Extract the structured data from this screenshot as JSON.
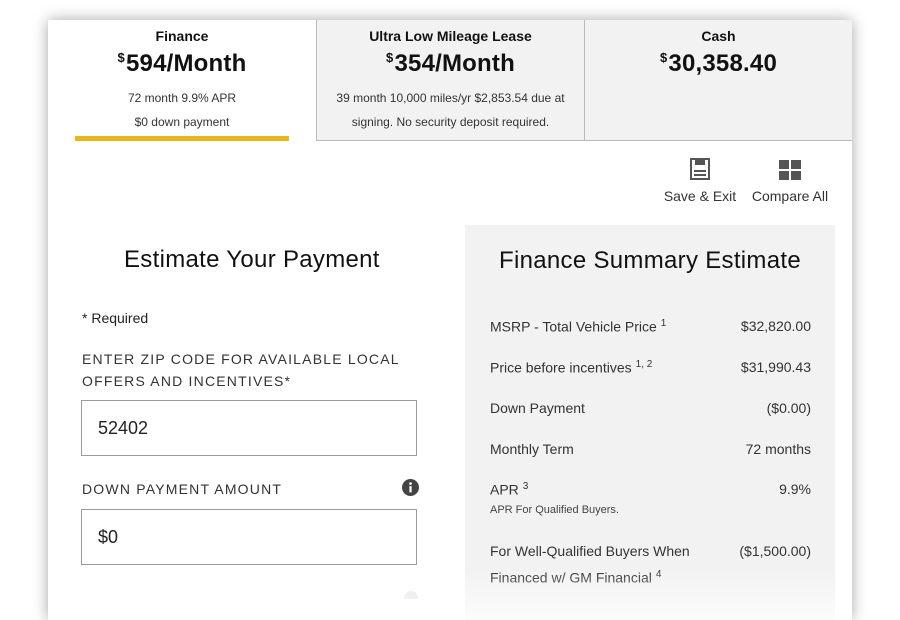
{
  "tabs": [
    {
      "name": "Finance",
      "currency": "$",
      "price": "594/Month",
      "desc_line1": "72 month 9.9% APR",
      "desc_line2": "$0 down payment",
      "selected": true
    },
    {
      "name": "Ultra Low Mileage Lease",
      "currency": "$",
      "price": "354/Month",
      "desc_line1": "39 month 10,000 miles/yr $2,853.54 due at",
      "desc_line2": "signing. No security deposit required.",
      "selected": false
    },
    {
      "name": "Cash",
      "currency": "$",
      "price": "30,358.40",
      "selected": false
    }
  ],
  "toolbar": {
    "save_label": "Save & Exit",
    "compare_label": "Compare All"
  },
  "estimate": {
    "title": "Estimate Your Payment",
    "required_note": "* Required",
    "zip_label": "ENTER ZIP CODE FOR AVAILABLE LOCAL OFFERS AND INCENTIVES*",
    "zip_value": "52402",
    "down_label": "DOWN PAYMENT AMOUNT",
    "down_value": "$0"
  },
  "summary": {
    "title": "Finance Summary Estimate",
    "rows": [
      {
        "label": "MSRP - Total Vehicle Price",
        "note": "1",
        "value": "$32,820.00"
      },
      {
        "label": "Price before incentives",
        "note": "1, 2",
        "value": "$31,990.43"
      },
      {
        "label": "Down Payment",
        "note": "",
        "value": "($0.00)"
      },
      {
        "label": "Monthly Term",
        "note": "",
        "value": "72 months"
      },
      {
        "label": "APR",
        "note": "3",
        "value": "9.9%",
        "sub": "APR For Qualified Buyers."
      },
      {
        "label": "For Well-Qualified Buyers When Financed w/ GM Financial",
        "note": "4",
        "value": "($1,500.00)"
      }
    ]
  },
  "colors": {
    "accent": "#e8b81a",
    "tab_inactive_bg": "#f2f2f2",
    "summary_bg": "#f2f2f2"
  }
}
